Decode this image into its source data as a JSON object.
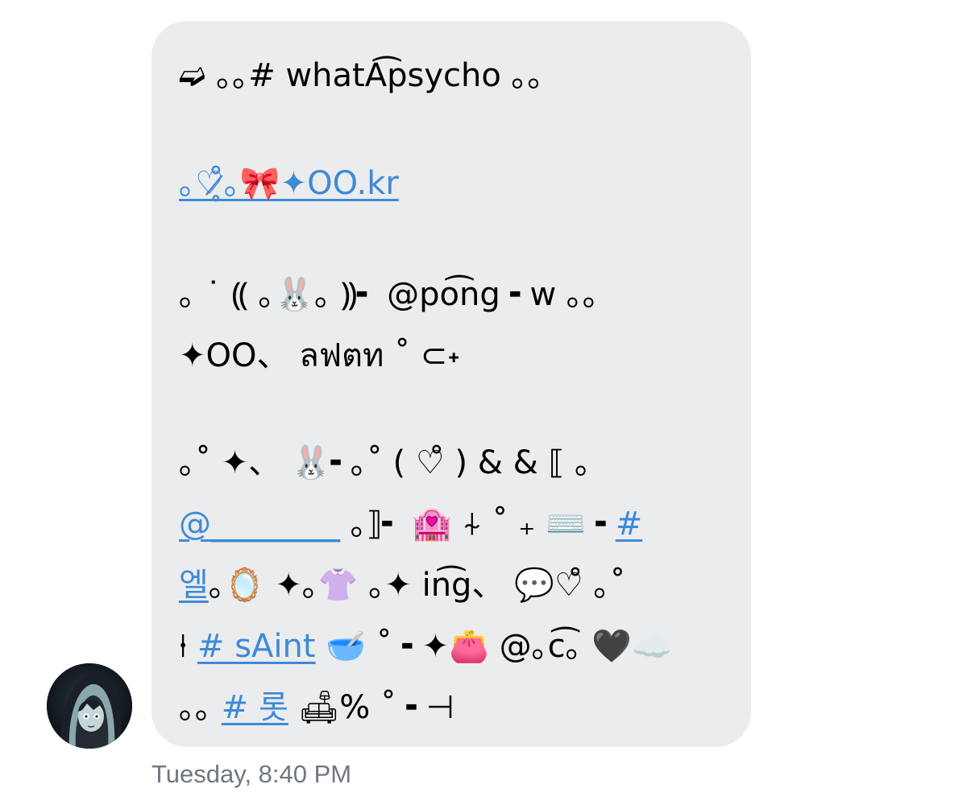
{
  "message": {
    "lines": [
      {
        "plain": "➫ ｡｡# whatA͡psycho ｡｡"
      },
      {
        "link": "｡♡̷̥̊｡🎀✦OO.kr"
      },
      {
        "plain": "｡ ˙ ⸨ ｡🐰｡ ⸩╸ @po͡ng ╸w ｡｡"
      },
      {
        "plain": "✦OO、 ลฟตท ˚ ⊂˖"
      },
      {
        "plain": "｡˚ ✦、 🐰╸｡˚ ( ♡̊ ) & & ⟦ ｡"
      },
      {
        "link_a": "@________",
        "plain_b": " ｡⟧╸ 🏩 ⍭ ˚ ₊ ⌨️ ╸",
        "link_c": "#"
      },
      {
        "link_a": "엘",
        "plain_b": "｡🪞 ✦｡👚 ｡✦ in͡g、 💬♡̊ ｡˚"
      },
      {
        "plain_a": "⍿ ",
        "link_b": "# sAint",
        "plain_c": " 🥣 ˚ ╸✦👛 @｡c͡｡ 🖤☁️"
      },
      {
        "plain_a": "｡｡ ",
        "link_b": "# 롯",
        "plain_c": " 🛋% ˚ ╸⊣"
      }
    ]
  },
  "avatar": {
    "icon": "profile-avatar-hooded-figure"
  },
  "timestamp": "Tuesday, 8:40 PM",
  "colors": {
    "bubble": "#ebeced",
    "link": "#3f8ad8",
    "timestamp": "#6f7781"
  }
}
